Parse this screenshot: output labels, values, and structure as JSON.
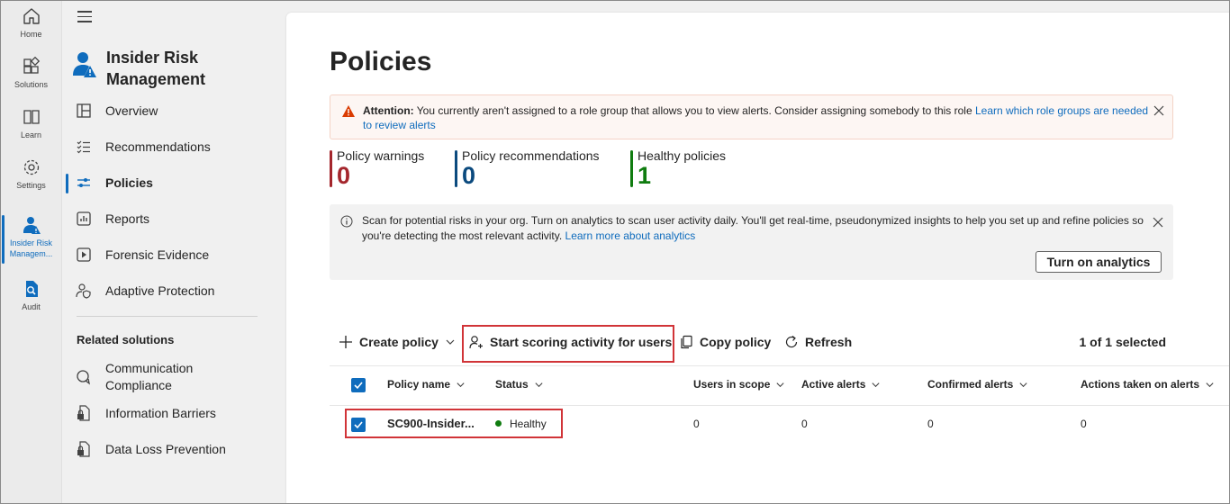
{
  "rail": {
    "items": [
      {
        "label": "Home"
      },
      {
        "label": "Solutions"
      },
      {
        "label": "Learn"
      },
      {
        "label": "Settings"
      },
      {
        "label_line1": "Insider Risk",
        "label_line2": "Managem..."
      },
      {
        "label": "Audit"
      }
    ]
  },
  "nav": {
    "app_title": "Insider Risk Management",
    "items": [
      {
        "label": "Overview",
        "icon": "overview-icon"
      },
      {
        "label": "Recommendations",
        "icon": "checklist-icon"
      },
      {
        "label": "Policies",
        "icon": "sliders-icon"
      },
      {
        "label": "Reports",
        "icon": "chart-icon"
      },
      {
        "label": "Forensic Evidence",
        "icon": "play-icon"
      },
      {
        "label": "Adaptive Protection",
        "icon": "person-shield-icon"
      }
    ],
    "related_heading": "Related solutions",
    "related": [
      {
        "label_line1": "Communication",
        "label_line2": "Compliance"
      },
      {
        "label": "Information Barriers"
      },
      {
        "label": "Data Loss Prevention"
      }
    ]
  },
  "page": {
    "title": "Policies",
    "attention": {
      "label": "Attention:",
      "text": " You currently aren't assigned to a role group that allows you to view alerts. Consider assigning somebody to this role ",
      "link": "Learn which role groups are needed to review alerts"
    },
    "stats": [
      {
        "label": "Policy warnings",
        "value": "0",
        "color": "#a4262c"
      },
      {
        "label": "Policy recommendations",
        "value": "0",
        "color": "#0b4a7e"
      },
      {
        "label": "Healthy policies",
        "value": "1",
        "color": "#107c10"
      }
    ],
    "analytics": {
      "text": "Scan for potential risks in your org. Turn on analytics to scan user activity daily. You'll get real-time, pseudonymized insights to help you set up and refine policies so you're detecting the most relevant activity. ",
      "link": "Learn more about analytics",
      "button": "Turn on analytics"
    },
    "toolbar": {
      "create": "Create policy",
      "start_scoring": "Start scoring activity for users",
      "copy": "Copy policy",
      "refresh": "Refresh",
      "selected": "1 of 1 selected"
    },
    "table": {
      "headers": [
        "Policy name",
        "Status",
        "Users in scope",
        "Active alerts",
        "Confirmed alerts",
        "Actions taken on alerts"
      ],
      "rows": [
        {
          "name": "SC900-Insider...",
          "status": "Healthy",
          "users_in_scope": "0",
          "active_alerts": "0",
          "confirmed_alerts": "0",
          "actions_taken": "0"
        }
      ]
    }
  },
  "colors": {
    "accent": "#0f6cbd",
    "highlight": "#d13438"
  }
}
